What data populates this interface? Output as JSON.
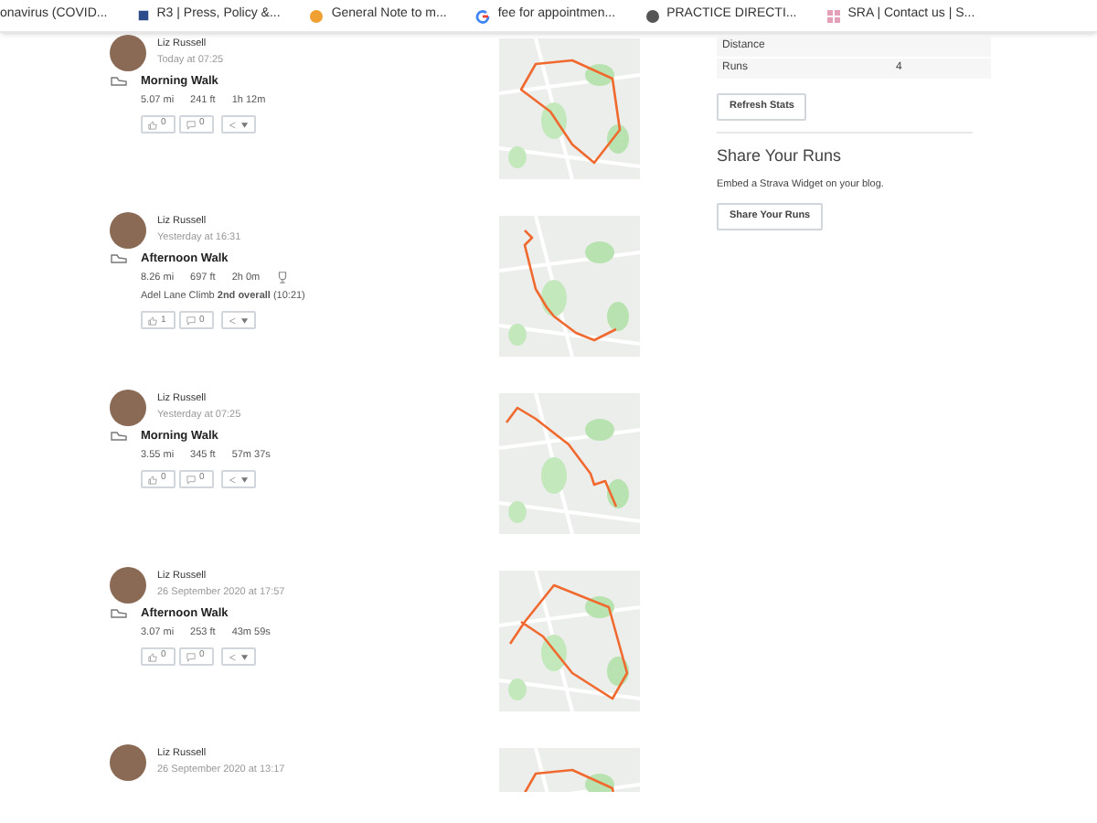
{
  "bookmarks": [
    {
      "label": "onavirus (COVID..."
    },
    {
      "label": "R3 | Press, Policy &..."
    },
    {
      "label": "General Note to m..."
    },
    {
      "label": "fee for appointmen..."
    },
    {
      "label": "PRACTICE DIRECTI..."
    },
    {
      "label": "SRA | Contact us | S..."
    }
  ],
  "activities": [
    {
      "athlete": "Liz Russell",
      "time": "Today at 07:25",
      "title": "Morning Walk",
      "stats": [
        "5.07 mi",
        "241 ft",
        "1h 12m"
      ],
      "kudos": "0",
      "comments": "0"
    },
    {
      "athlete": "Liz Russell",
      "time": "Yesterday at 16:31",
      "title": "Afternoon Walk",
      "stats": [
        "8.26 mi",
        "697 ft",
        "2h 0m"
      ],
      "achievement": "Adel Lane Climb **2nd overall** (10:21)",
      "kudos": "1",
      "comments": "0"
    },
    {
      "athlete": "Liz Russell",
      "time": "Yesterday at 07:25",
      "title": "Morning Walk",
      "stats": [
        "3.55 mi",
        "345 ft",
        "57m 37s"
      ],
      "kudos": "0",
      "comments": "0"
    },
    {
      "athlete": "Liz Russell",
      "time": "26 September 2020 at 17:57",
      "title": "Afternoon Walk",
      "stats": [
        "3.07 mi",
        "253 ft",
        "43m 59s"
      ],
      "kudos": "0",
      "comments": "0"
    },
    {
      "athlete": "Liz Russell",
      "time": "26 September 2020 at 13:17"
    }
  ],
  "stats_table": [
    {
      "label": "Distance"
    },
    {
      "label": "Runs",
      "value": "4"
    }
  ],
  "refresh_button": "Refresh Stats",
  "share": {
    "heading": "Share Your Runs",
    "text": "Embed a Strava Widget on your blog.",
    "button": "Share Your Runs"
  }
}
